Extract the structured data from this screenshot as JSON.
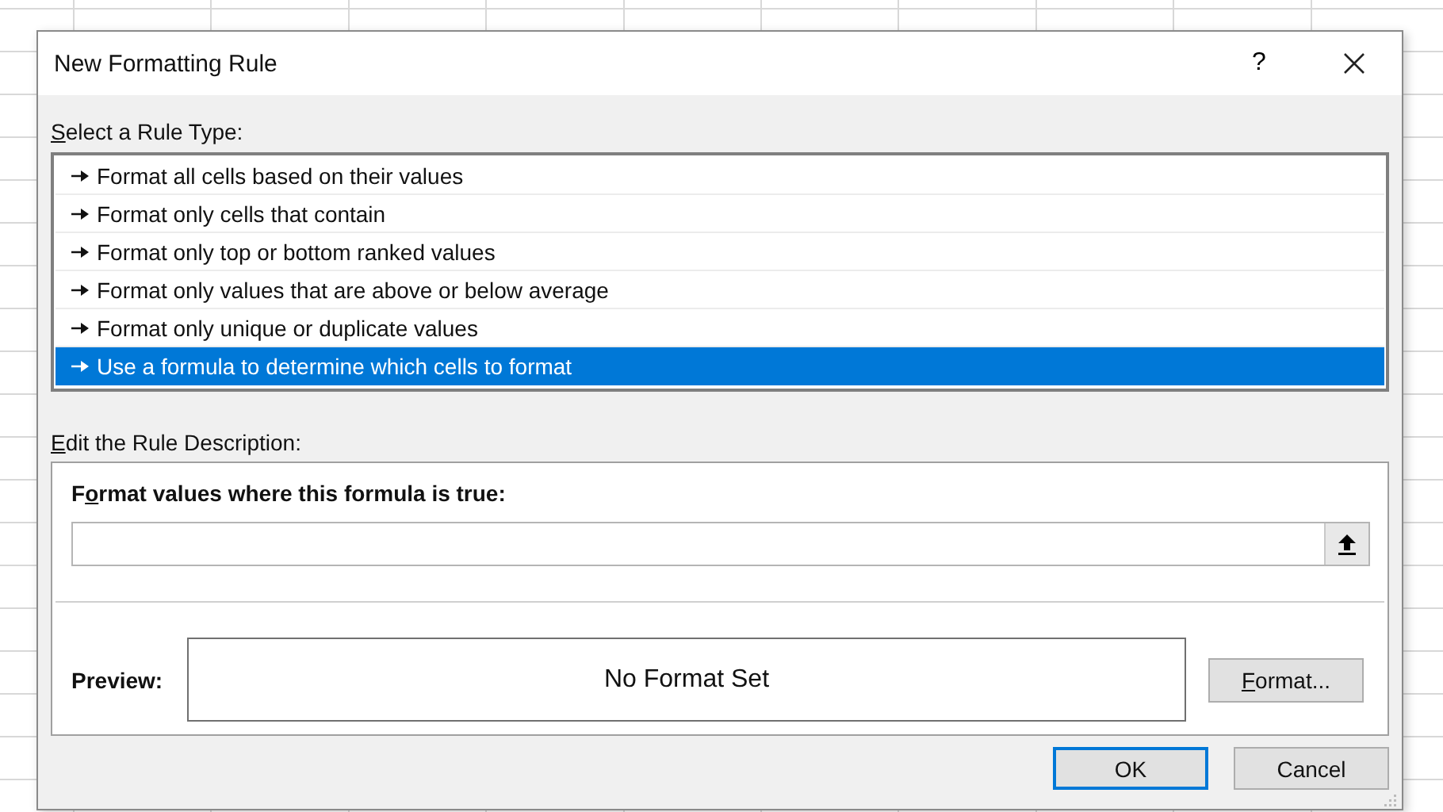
{
  "window": {
    "title": "New Formatting Rule",
    "help": "?"
  },
  "rule_type_label": {
    "key": "S",
    "after": "elect a Rule Type:"
  },
  "rule_types": [
    {
      "label": "Format all cells based on their values",
      "selected": false
    },
    {
      "label": "Format only cells that contain",
      "selected": false
    },
    {
      "label": "Format only top or bottom ranked values",
      "selected": false
    },
    {
      "label": "Format only values that are above or below average",
      "selected": false
    },
    {
      "label": "Format only unique or duplicate values",
      "selected": false
    },
    {
      "label": "Use a formula to determine which cells to format",
      "selected": true
    }
  ],
  "description_label": {
    "key": "E",
    "after": "dit the Rule Description:"
  },
  "formula": {
    "label": {
      "before": "F",
      "key": "o",
      "after": "rmat values where this formula is true:"
    }
  },
  "preview": {
    "label": "Preview:",
    "text": "No Format Set",
    "button": {
      "key": "F",
      "after": "ormat..."
    }
  },
  "buttons": [
    {
      "label": "OK",
      "default": true
    },
    {
      "label": "Cancel",
      "default": false
    }
  ]
}
